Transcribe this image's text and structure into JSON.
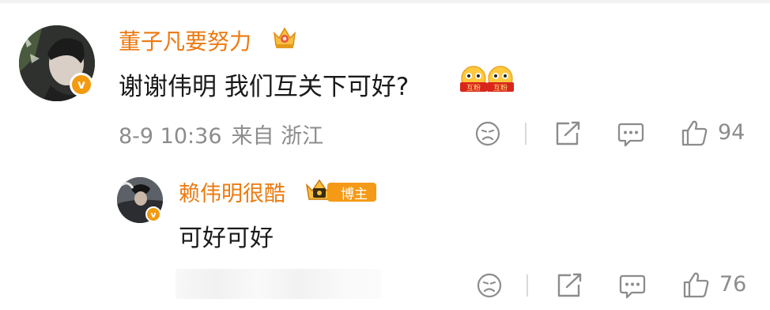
{
  "comment": {
    "author": "董子凡要努力",
    "text": "谢谢伟明 我们互关下可好?",
    "emoji_label": "互粉",
    "emoji_count": 2,
    "date": "8-9 10:36",
    "source": "来自 浙江",
    "likes": "94"
  },
  "reply": {
    "author": "赖伟明很酷",
    "badge": "博主",
    "text": "可好可好",
    "likes": "76"
  },
  "colors": {
    "name": "#ec7a10",
    "badge": "#f29b0f",
    "meta": "#8c8c8c"
  }
}
